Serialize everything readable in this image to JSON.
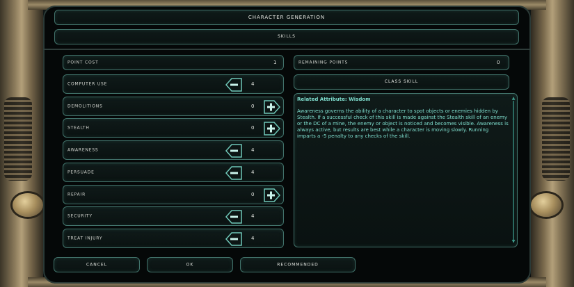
{
  "header": {
    "title": "Character Generation",
    "subtitle": "Skills"
  },
  "skills_panel": {
    "point_cost": {
      "label": "Point Cost",
      "value": "1"
    },
    "rows": [
      {
        "label": "Computer Use",
        "value": "4",
        "control": "minus"
      },
      {
        "label": "Demolitions",
        "value": "0",
        "control": "plus"
      },
      {
        "label": "Stealth",
        "value": "0",
        "control": "plus"
      },
      {
        "label": "Awareness",
        "value": "4",
        "control": "minus"
      },
      {
        "label": "Persuade",
        "value": "4",
        "control": "minus"
      },
      {
        "label": "Repair",
        "value": "0",
        "control": "plus"
      },
      {
        "label": "Security",
        "value": "4",
        "control": "minus"
      },
      {
        "label": "Treat Injury",
        "value": "4",
        "control": "minus"
      }
    ]
  },
  "right_panel": {
    "remaining": {
      "label": "Remaining Points",
      "value": "0"
    },
    "class_skill": "Class Skill",
    "description": {
      "heading": "Related Attribute: Wisdom",
      "body": "Awareness governs the ability of a character to spot objects or enemies hidden by Stealth. If a successful check of this skill is made against the Stealth skill of an enemy or the DC of a mine, the enemy or object is noticed and becomes visible. Awareness is always active, but results are best while a character is moving slowly. Running imparts a -5 penalty to any checks of the skill."
    }
  },
  "footer": {
    "cancel": "Cancel",
    "ok": "OK",
    "recommended": "Recommended"
  },
  "colors": {
    "accent": "#7fdfcf",
    "border": "#41726a",
    "frame": "#9b8a67"
  },
  "icons": {
    "minus": "minus-arrow-icon",
    "plus": "plus-arrow-icon"
  }
}
